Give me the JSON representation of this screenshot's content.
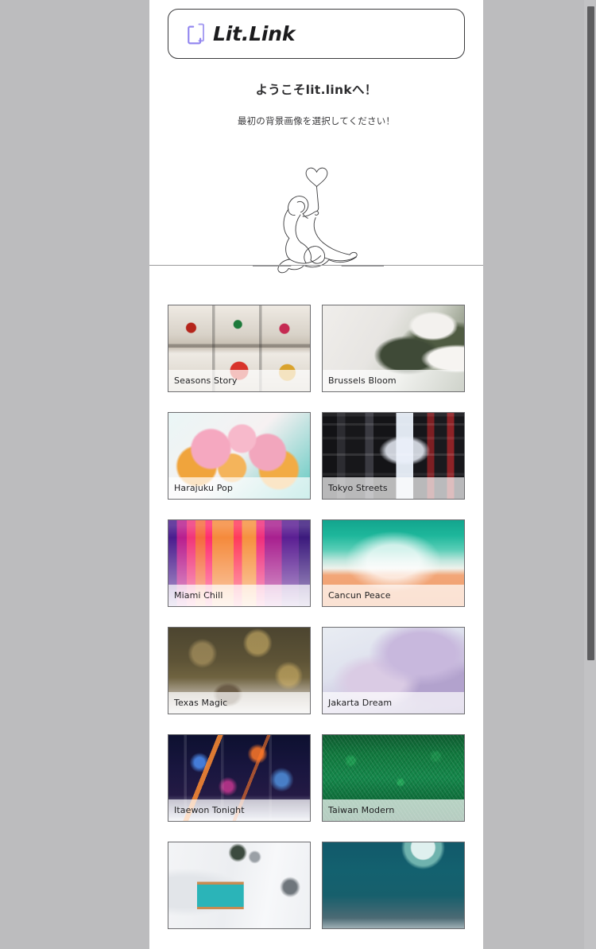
{
  "page": {
    "background_color": "#bcbcbe",
    "panel_color": "#ffffff"
  },
  "header": {
    "logo_icon": "litlink-bracket-icon",
    "logo_text": "Lit.Link",
    "logo_accent_color": "#9a92ee"
  },
  "welcome": {
    "title": "ようこそlit.linkへ！",
    "subtitle": "最初の背景画像を選択してください！",
    "illustration_name": "line-art-woman-with-heart-balloon"
  },
  "gallery": {
    "cards": [
      {
        "label": "Seasons Story",
        "art": "th-seasons"
      },
      {
        "label": "Brussels Bloom",
        "art": "th-brussels"
      },
      {
        "label": "Harajuku Pop",
        "art": "th-harajuku"
      },
      {
        "label": "Tokyo Streets",
        "art": "th-tokyo"
      },
      {
        "label": "Miami Chill",
        "art": "th-miami"
      },
      {
        "label": "Cancun Peace",
        "art": "th-cancun"
      },
      {
        "label": "Texas Magic",
        "art": "th-texas"
      },
      {
        "label": "Jakarta Dream",
        "art": "th-jakarta"
      },
      {
        "label": "Itaewon Tonight",
        "art": "th-itaewon"
      },
      {
        "label": "Taiwan Modern",
        "art": "th-taiwan"
      },
      {
        "label": "",
        "art": "th-interior"
      },
      {
        "label": "",
        "art": "th-moon"
      }
    ]
  },
  "help": {
    "icon": "question-mark-circle-icon",
    "color": "#7b7bf0"
  },
  "scrollbar": {
    "track_color": "#c2c2c4",
    "thumb_color": "#5d5d5f"
  }
}
